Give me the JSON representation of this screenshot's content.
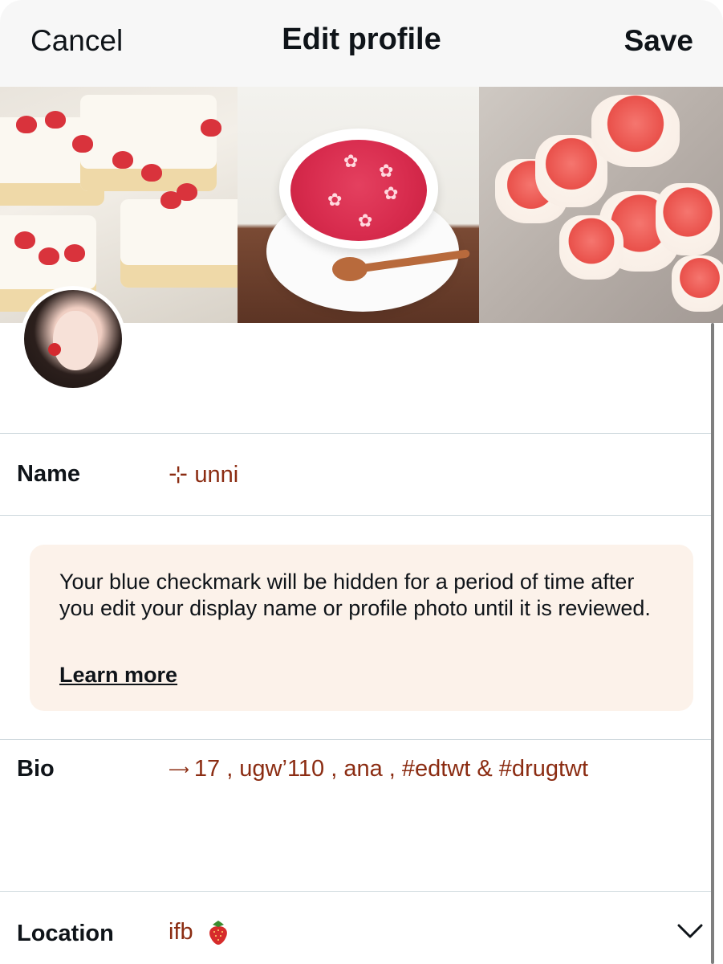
{
  "header": {
    "cancel_label": "Cancel",
    "title": "Edit profile",
    "save_label": "Save"
  },
  "profile": {
    "name_label": "Name",
    "name_value": "⊹ unni",
    "notice": {
      "text": "Your blue checkmark will be hidden for a period of time after you edit your display name or profile photo until it is reviewed.",
      "link_label": "Learn more"
    },
    "bio_label": "Bio",
    "bio_prefix": "⟶",
    "bio_value": "17 , ugw’110 , ana , #edtwt & #drugtwt",
    "location_label": "Location",
    "location_value": "ifb"
  },
  "icons": {
    "location_emoji": "strawberry-icon",
    "dropdown": "chevron-down-icon"
  },
  "colors": {
    "value_text": "#8b2c12",
    "notice_bg": "#fcf2ea",
    "header_bg": "#f7f7f7"
  }
}
